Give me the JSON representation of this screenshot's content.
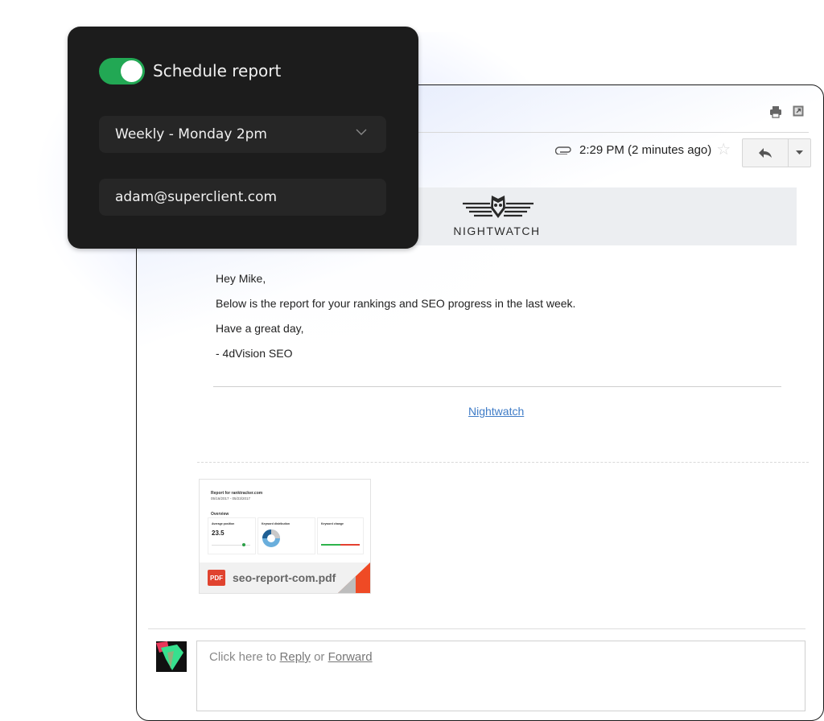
{
  "schedule_panel": {
    "toggle_label": "Schedule report",
    "toggle_on": true,
    "frequency_value": "Weekly - Monday 2pm",
    "recipient_email": "adam@superclient.com",
    "accent_color": "#22a854"
  },
  "email": {
    "timestamp": "2:29 PM (2 minutes ago)",
    "icons": [
      "print-icon",
      "popout-icon",
      "paperclip-icon",
      "star-icon",
      "reply-icon",
      "chevron-down-icon"
    ],
    "logo_text": "NIGHTWATCH",
    "body": [
      "Hey Mike,",
      "Below is the report for your rankings and SEO progress in the last week.",
      "Have a great day,",
      "- 4dVision SEO"
    ],
    "footer_link": "Nightwatch",
    "link_color": "#3f7cc7",
    "attachment": {
      "filename": "seo-report-com.pdf",
      "badge": "PDF",
      "preview_title": "Report for ranktracker.com",
      "preview_dates": "05/16/2017 - 05/23/2017",
      "preview_section": "Overview",
      "preview_cards": [
        "Average position",
        "Keyword distribution",
        "Keyword change"
      ],
      "preview_avg": "23.5"
    },
    "reply": {
      "prefix": "Click here to ",
      "reply_link": "Reply",
      "middle": " or ",
      "forward_link": "Forward"
    }
  }
}
